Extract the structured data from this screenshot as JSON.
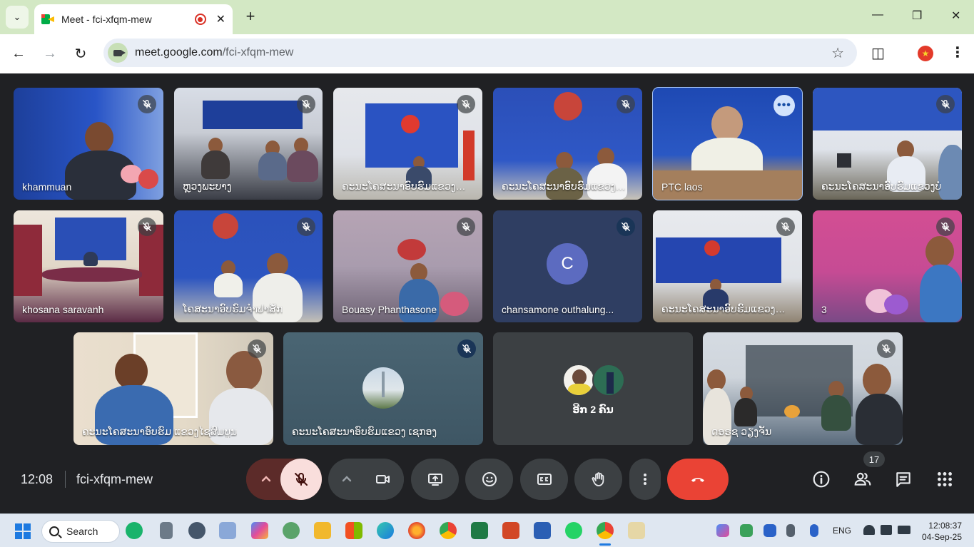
{
  "browser": {
    "tab_title": "Meet - fci-xfqm-mew",
    "url_host": "meet.google.com",
    "url_path": "/fci-xfqm-mew"
  },
  "tiles": [
    {
      "label": "khammuan",
      "muted": true
    },
    {
      "label": "ຫຼວງພະບາງ",
      "muted": true
    },
    {
      "label": "ຄະນະໂຄສະນາອົບຮົມແຂວງອຸ...",
      "muted": true
    },
    {
      "label": "ຄະນະໂຄສະນາອົບຮົມແຂວງຫົ...",
      "muted": true
    },
    {
      "label": "PTC laos",
      "muted": false,
      "active": true
    },
    {
      "label": "ຄະນະໂຄສະນາອົບຮົມແຂວງບໍ",
      "muted": true
    },
    {
      "label": "khosana saravanh",
      "muted": true
    },
    {
      "label": "ໂຄສະນາອົບຮົມຈຳປາສັກ",
      "muted": true
    },
    {
      "label": "Bouasy Phanthasone",
      "muted": true
    },
    {
      "label": "chansamone outhalung...",
      "muted": true,
      "avatar_letter": "C"
    },
    {
      "label": "ຄະນະໂຄສະນາອົບຮົມແຂວງບໍ...",
      "muted": true
    },
    {
      "label": "3",
      "muted": true
    },
    {
      "label": "ຄະນະໂຄສະນາອົບຮົມ ແຂວງໄຊສົມບູນ",
      "muted": true
    },
    {
      "label": "ຄະນະໂຄສະນາອົບຮົມແຂວງ ເຊກອງ",
      "muted": true
    },
    {
      "label": "ອີກ 2 ຄົນ",
      "muted": false
    },
    {
      "label": "ດອຣຊ ວຽງຈັນ",
      "muted": true
    }
  ],
  "bottom_bar": {
    "time": "12:08",
    "meeting_code": "fci-xfqm-mew",
    "participant_count": "17"
  },
  "taskbar": {
    "search_label": "Search",
    "lang": "ENG",
    "clock_time": "12:08:37",
    "clock_date": "04-Sep-25"
  },
  "colors": {
    "end_call": "#ea4335",
    "mic_off_bg": "#f9dedc",
    "tab_strip": "#d3e8c4"
  }
}
